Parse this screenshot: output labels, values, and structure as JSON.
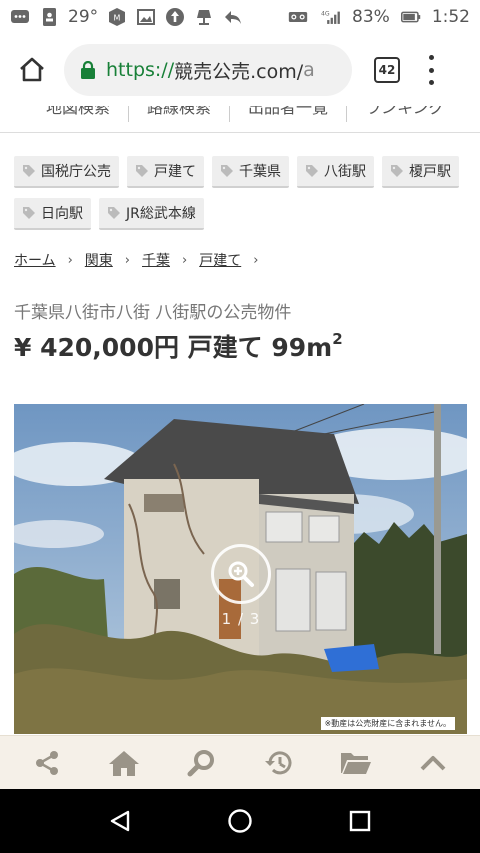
{
  "status_bar": {
    "temperature": "29°",
    "battery": "83%",
    "time": "1:52",
    "signal_label": "4G",
    "left_icons": [
      "chat-icon",
      "contact-icon",
      "weather-icon",
      "app-icon",
      "image-icon",
      "upload-icon",
      "lamp-icon",
      "reply-icon"
    ],
    "right_icons": [
      "voicemail-icon",
      "signal-icon",
      "battery-icon"
    ]
  },
  "url_bar": {
    "scheme": "https://",
    "host": "競売公売.com/",
    "tail": "a",
    "tab_count": "42"
  },
  "sub_nav": {
    "items": [
      "地図検索",
      "路線検索",
      "出品者一覧",
      "ランキング"
    ]
  },
  "tags": [
    "国税庁公売",
    "戸建て",
    "千葉県",
    "八街駅",
    "榎戸駅",
    "日向駅",
    "JR総武本線"
  ],
  "breadcrumb": {
    "items": [
      "ホーム",
      "関東",
      "千葉",
      "戸建て"
    ],
    "separator": "›"
  },
  "listing": {
    "subtitle": "千葉県八街市八街 八街駅の公売物件",
    "price": "¥ 420,000円 戸建て 99m",
    "area_sup": "2"
  },
  "photo": {
    "counter": "1 / 3",
    "caption": "※動産は公売財産に含まれません。"
  },
  "toolbar": {
    "icons": [
      "share-icon",
      "home-icon",
      "search-icon",
      "history-icon",
      "folder-icon",
      "scroll-top-icon"
    ]
  },
  "colors": {
    "accent_green": "#188038",
    "toolbar_bg": "#f5f0e8",
    "tag_bg": "#eeeeee"
  }
}
